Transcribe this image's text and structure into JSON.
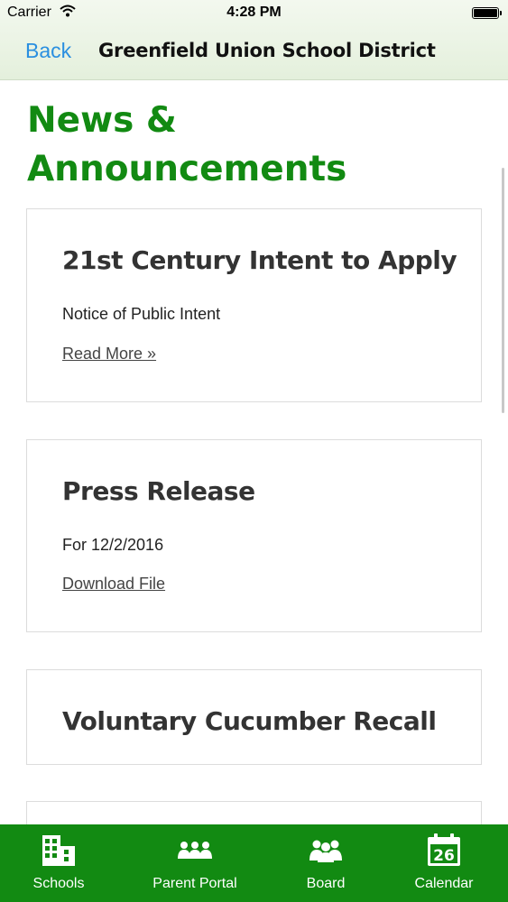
{
  "status_bar": {
    "carrier": "Carrier",
    "time": "4:28 PM"
  },
  "nav": {
    "back_label": "Back",
    "title": "Greenfield Union School District"
  },
  "page": {
    "title": "News & Announcements"
  },
  "cards": [
    {
      "title": "21st Century Intent to Apply",
      "text": "Notice of Public Intent",
      "link": "Read More »"
    },
    {
      "title": "Press Release",
      "text": "For 12/2/2016",
      "link": "Download File"
    },
    {
      "title": "Voluntary Cucumber Recall"
    }
  ],
  "tabbar": {
    "tabs": [
      {
        "label": "Schools",
        "icon": "building-icon"
      },
      {
        "label": "Parent Portal",
        "icon": "parents-icon"
      },
      {
        "label": "Board",
        "icon": "board-icon"
      },
      {
        "label": "Calendar",
        "icon": "calendar-icon",
        "icon_text": "26"
      }
    ]
  },
  "colors": {
    "accent": "#128a12",
    "link": "#2a8fe0",
    "header_bg": "#e4f0dc"
  }
}
